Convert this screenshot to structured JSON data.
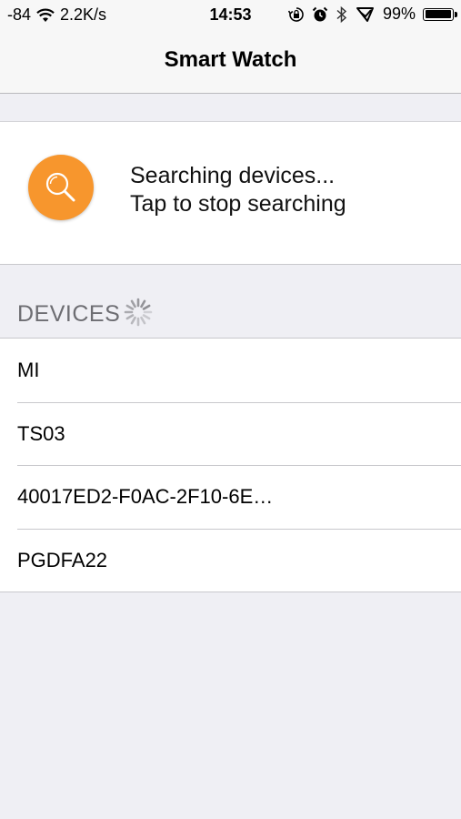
{
  "status_bar": {
    "signal": "-84",
    "speed": "2.2K/s",
    "time": "14:53",
    "battery_percent": "99%",
    "battery_level": 0.99,
    "icons": [
      "wifi-icon",
      "rotation-lock-icon",
      "alarm-icon",
      "bluetooth-icon",
      "location-icon",
      "battery-icon"
    ]
  },
  "nav": {
    "title": "Smart Watch"
  },
  "search": {
    "line1": "Searching devices...",
    "line2": "Tap to stop searching",
    "icon": "search-icon",
    "accent": "#f7962d"
  },
  "devices": {
    "header": "DEVICES",
    "items": [
      {
        "name": "MI"
      },
      {
        "name": "TS03"
      },
      {
        "name": "40017ED2-F0AC-2F10-6E…"
      },
      {
        "name": "PGDFA22"
      }
    ]
  }
}
